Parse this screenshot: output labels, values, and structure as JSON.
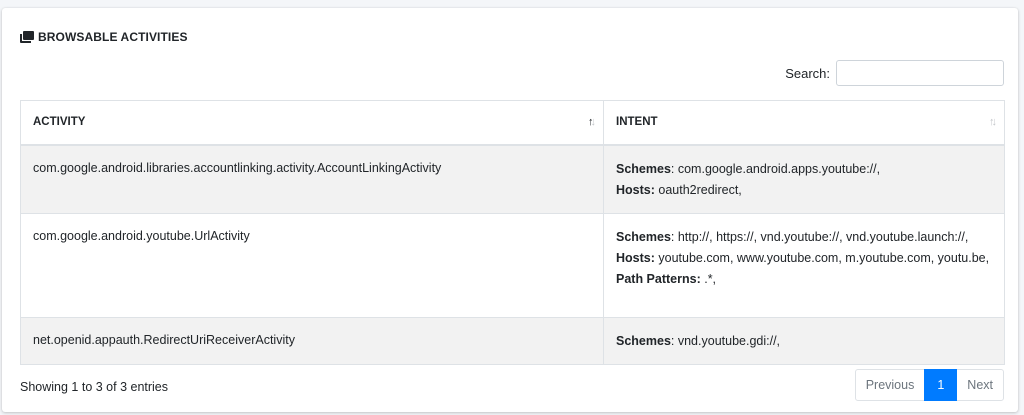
{
  "card": {
    "title": "BROWSABLE ACTIVITIES",
    "title_icon": "clone-icon"
  },
  "search": {
    "label": "Search:",
    "value": "",
    "placeholder": ""
  },
  "table": {
    "headers": {
      "activity": "ACTIVITY",
      "intent": "INTENT"
    },
    "sort": {
      "activity": "sorted-ascending",
      "intent": "unsorted"
    },
    "rows": [
      {
        "activity": "com.google.android.libraries.accountlinking.activity.AccountLinkingActivity",
        "schemes_label": "Schemes",
        "schemes_sep": ": ",
        "schemes": "com.google.android.apps.youtube://,",
        "hosts_label": "Hosts:",
        "hosts": " oauth2redirect,"
      },
      {
        "activity": "com.google.android.youtube.UrlActivity",
        "schemes_label": "Schemes",
        "schemes_sep": ": ",
        "schemes": "http://, https://, vnd.youtube://, vnd.youtube.launch://,",
        "hosts_label": "Hosts:",
        "hosts": " youtube.com, www.youtube.com, m.youtube.com, youtu.be,",
        "path_patterns_label": "Path Patterns:",
        "path_patterns": " .*,"
      },
      {
        "activity": "net.openid.appauth.RedirectUriReceiverActivity",
        "schemes_label": "Schemes",
        "schemes_sep": ": ",
        "schemes": "vnd.youtube.gdi://,"
      }
    ]
  },
  "footer": {
    "info": "Showing 1 to 3 of 3 entries",
    "pagination": {
      "previous": "Previous",
      "current": "1",
      "next": "Next"
    }
  },
  "colors": {
    "accent": "#007bff",
    "stripe": "#f2f2f2",
    "border": "#dee2e6"
  }
}
